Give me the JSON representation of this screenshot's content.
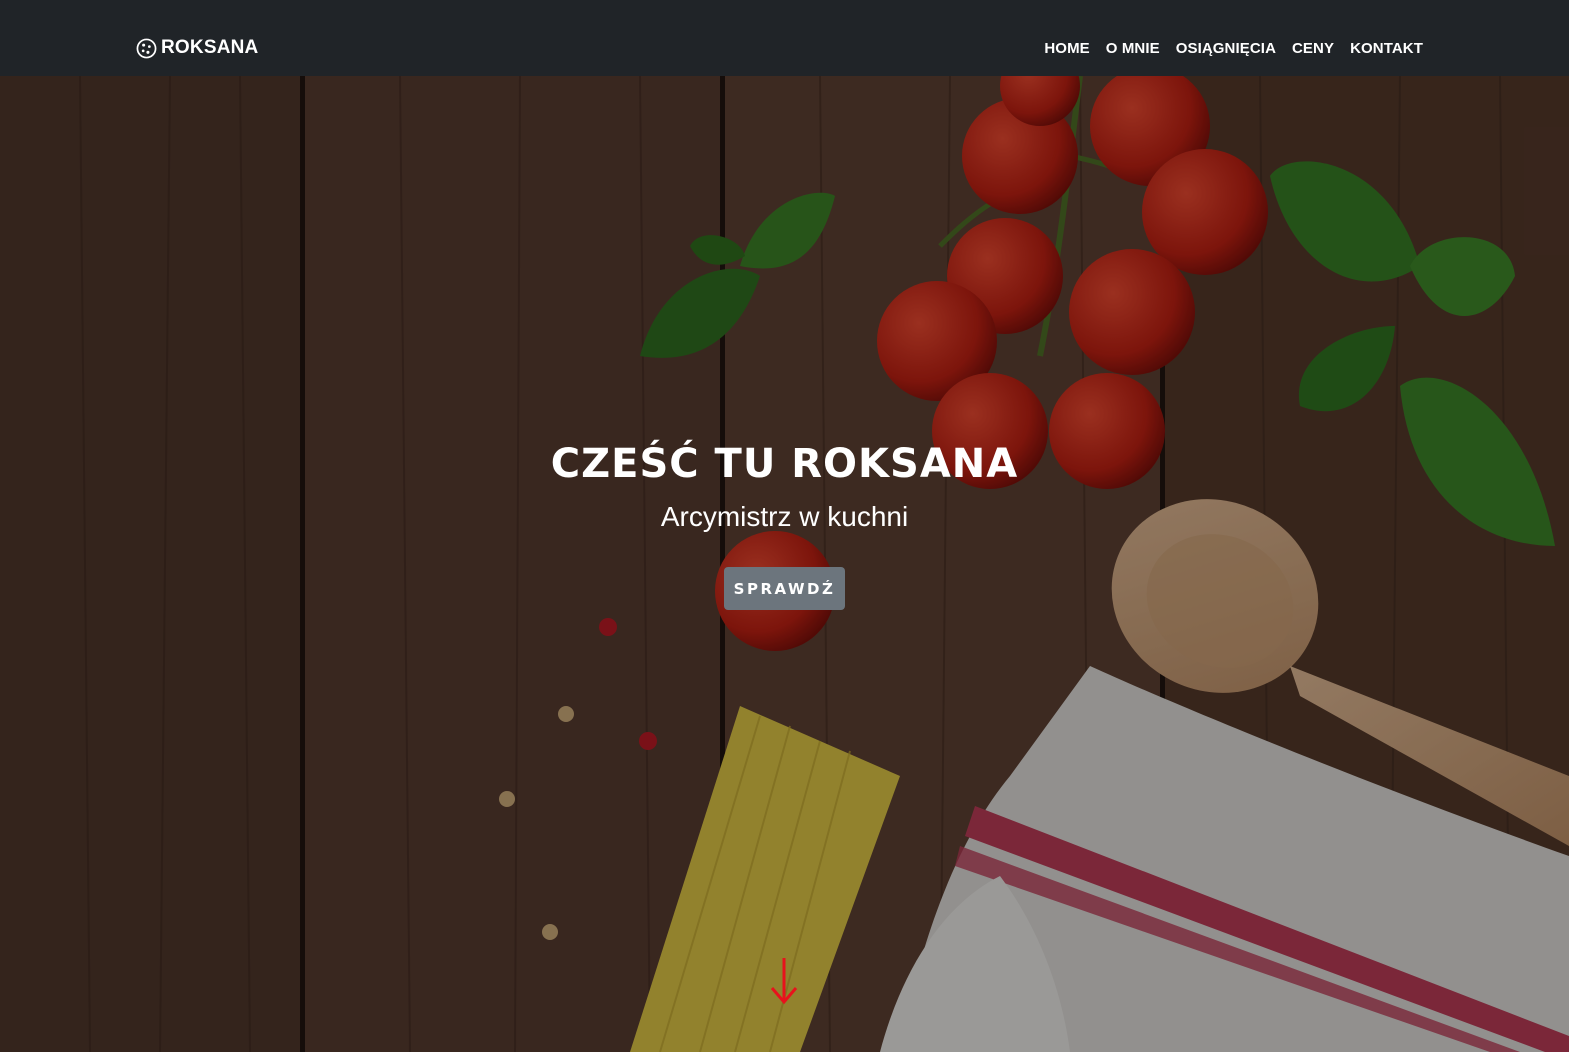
{
  "nav": {
    "brand": "ROKSANA",
    "brand_icon": "cookie-icon",
    "items": [
      {
        "label": "HOME"
      },
      {
        "label": "O MNIE"
      },
      {
        "label": "OSIĄGNIĘCIA"
      },
      {
        "label": "CENY"
      },
      {
        "label": "KONTAKT"
      }
    ]
  },
  "hero": {
    "title": "CZEŚĆ TU ROKSANA",
    "subtitle": "Arcymistrz w kuchni",
    "button": "SPRAWDŹ",
    "scroll_icon": "arrow-down-icon"
  },
  "colors": {
    "navbar": "#202428",
    "button": "#6c757d",
    "arrow": "#e8121c",
    "text": "#ffffff"
  }
}
